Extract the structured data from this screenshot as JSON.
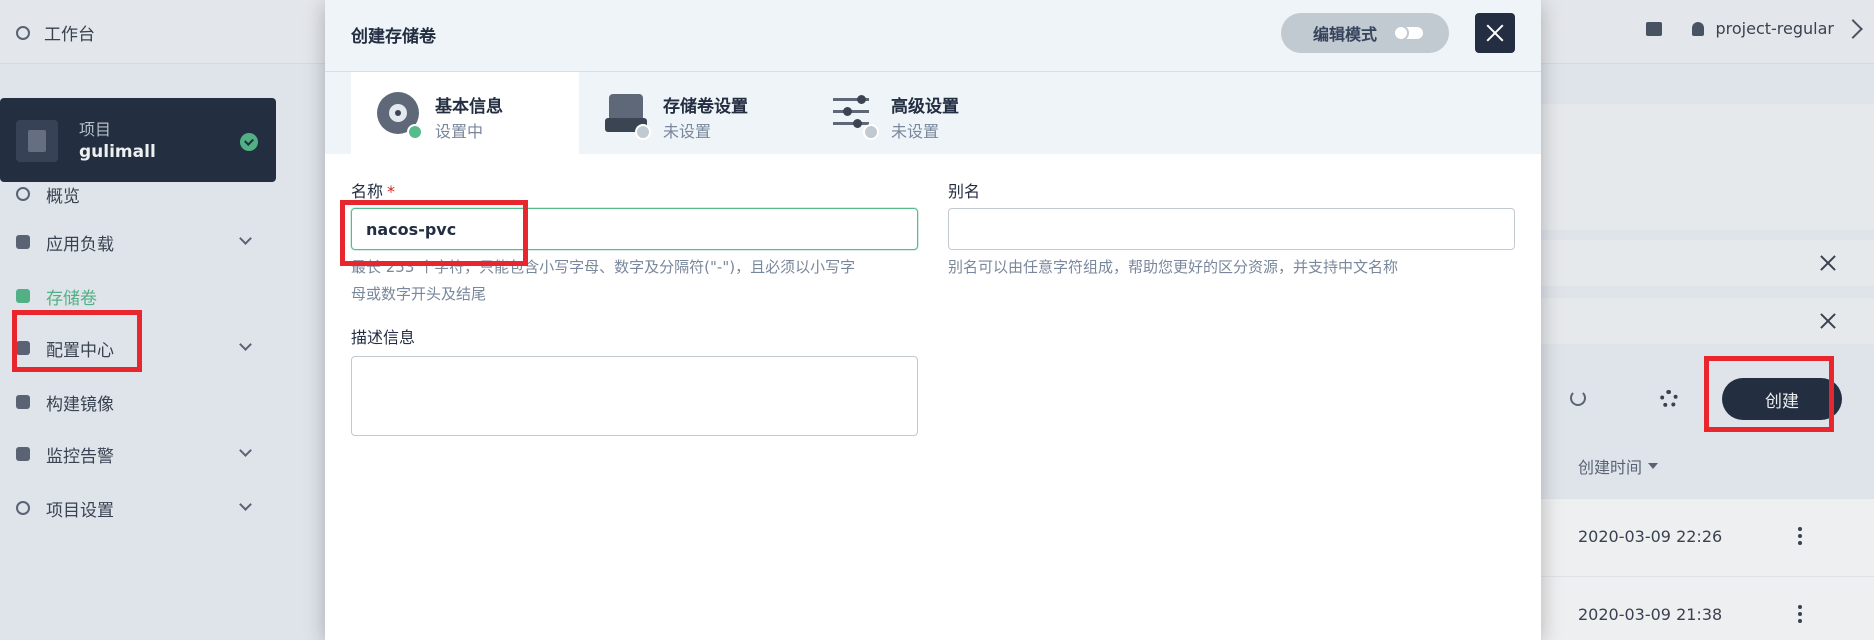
{
  "topbar": {
    "workspace_label": "工作台",
    "user_name": "project-regular"
  },
  "project": {
    "label": "项目",
    "name": "gulimall"
  },
  "sidebar": {
    "items": [
      {
        "label": "概览",
        "has_chevron": false
      },
      {
        "label": "应用负载",
        "has_chevron": true
      },
      {
        "label": "存储卷",
        "has_chevron": false,
        "active": true
      },
      {
        "label": "配置中心",
        "has_chevron": true
      },
      {
        "label": "构建镜像",
        "has_chevron": false
      },
      {
        "label": "监控告警",
        "has_chevron": true
      },
      {
        "label": "项目设置",
        "has_chevron": true
      }
    ]
  },
  "background": {
    "create_label": "创建",
    "created_time_header": "创建时间",
    "rows": [
      {
        "time": "2020-03-09 22:26"
      },
      {
        "time": "2020-03-09 21:38"
      }
    ]
  },
  "modal": {
    "title": "创建存储卷",
    "edit_mode_label": "编辑模式",
    "steps": [
      {
        "title": "基本信息",
        "status": "设置中"
      },
      {
        "title": "存储卷设置",
        "status": "未设置"
      },
      {
        "title": "高级设置",
        "status": "未设置"
      }
    ],
    "name_label": "名称",
    "required_mark": "*",
    "name_value": "nacos-pvc",
    "name_hint_line1": "最长 253 个字符，只能包含小写字母、数字及分隔符(\"-\")，且必须以小写字",
    "name_hint_line2": "母或数字开头及结尾",
    "alias_label": "别名",
    "alias_value": "",
    "alias_hint": "别名可以由任意字符组成，帮助您更好的区分资源，并支持中文名称",
    "desc_label": "描述信息",
    "desc_value": ""
  },
  "colors": {
    "accent": "#55bc8a",
    "dark": "#242e42",
    "highlight": "#e8262d"
  }
}
